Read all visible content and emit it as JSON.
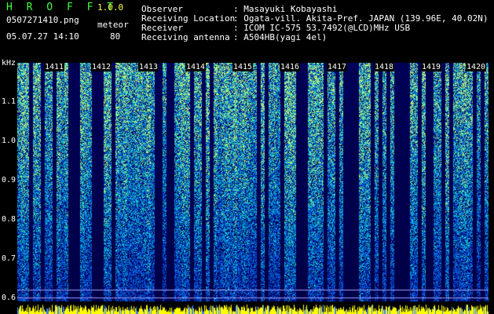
{
  "header": {
    "app_title": "H R O F F T",
    "version": "1.0.0",
    "filename": "0507271410.png",
    "mode_label": "meteor",
    "datetime": "05.07.27 14:10",
    "count": "80"
  },
  "info": [
    {
      "key": "Observer",
      "value": ": Masayuki Kobayashi"
    },
    {
      "key": "Receiving Location",
      "value": ": Ogata-vill. Akita-Pref. JAPAN (139.96E, 40.02N)"
    },
    {
      "key": "Receiver",
      "value": ": ICOM IC-575 53.7492(@LCD)MHz USB"
    },
    {
      "key": "Receiving antenna",
      "value": ": A504HB(yagi 4el)"
    }
  ],
  "axis": {
    "unit": "kHz",
    "ticks": [
      "1.1",
      "1.0",
      "0.9",
      "0.8",
      "0.7",
      "0.6"
    ]
  },
  "minutes": [
    "1411",
    "1412",
    "1413",
    "1414",
    "1415",
    "1416",
    "1417",
    "1418",
    "1419",
    "1420"
  ],
  "colors": {
    "background": "#000000",
    "spectrogram_low": "#0a1a8c",
    "spectrogram_high": "#35d08a",
    "title": "#3fff3f",
    "version": "#ffff44",
    "baseline": "#ffff00"
  }
}
